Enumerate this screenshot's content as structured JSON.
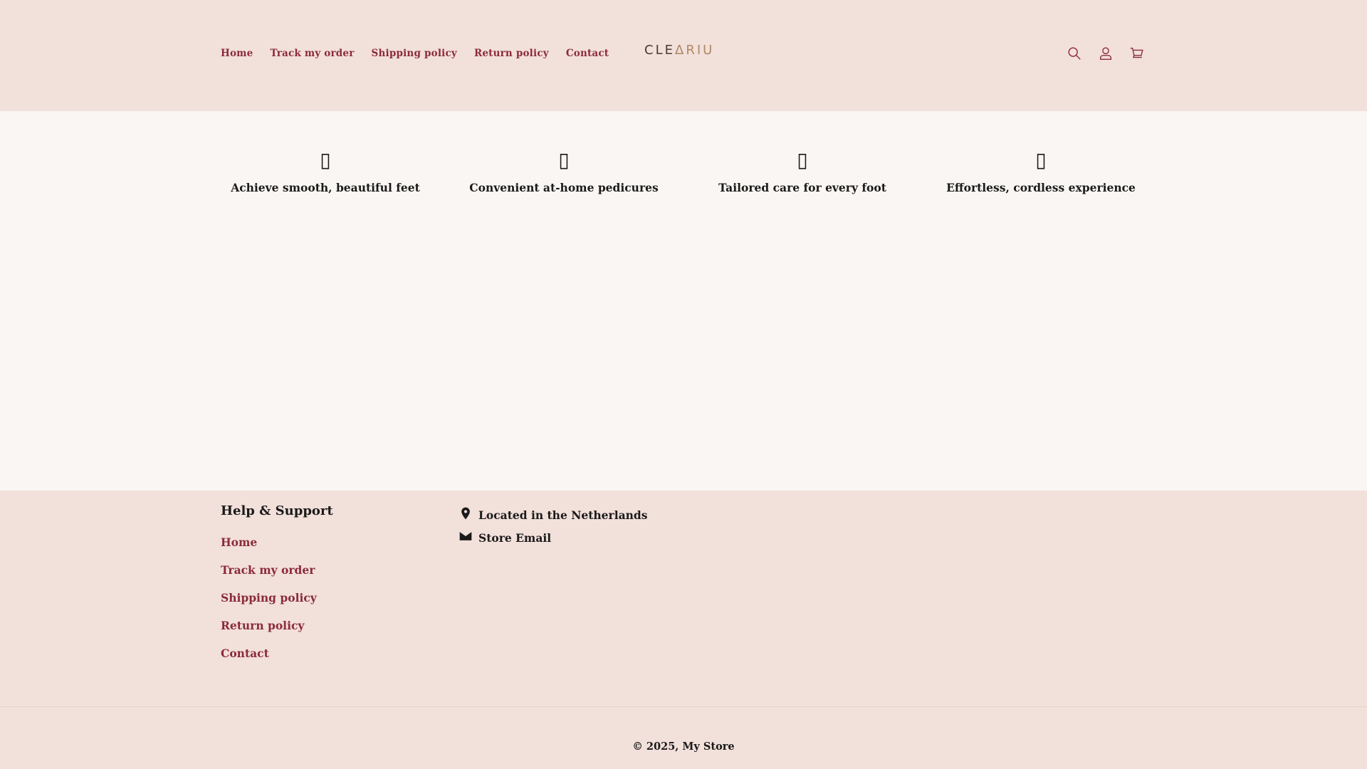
{
  "header": {
    "nav": [
      {
        "label": "Home"
      },
      {
        "label": "Track my order"
      },
      {
        "label": "Shipping policy"
      },
      {
        "label": "Return policy"
      },
      {
        "label": "Contact"
      }
    ],
    "logo": {
      "part1": "CLE",
      "mark": "Δ",
      "part2": "RIU"
    },
    "icons": [
      "search-icon",
      "account-icon",
      "cart-icon"
    ]
  },
  "features": [
    {
      "icon": "▯",
      "label": "Achieve smooth, beautiful feet"
    },
    {
      "icon": "▯",
      "label": "Convenient at-home pedicures"
    },
    {
      "icon": "▯",
      "label": "Tailored care for every foot"
    },
    {
      "icon": "▯",
      "label": "Effortless, cordless experience"
    }
  ],
  "footer": {
    "heading": "Help & Support",
    "links": [
      {
        "label": "Home"
      },
      {
        "label": "Track my order"
      },
      {
        "label": "Shipping policy"
      },
      {
        "label": "Return policy"
      },
      {
        "label": "Contact"
      }
    ],
    "contact": {
      "location": "Located in the Netherlands",
      "email": "Store Email"
    },
    "copyright": "© 2025, My Store"
  },
  "colors": {
    "header_bg": "#f2e0da",
    "body_bg": "#f9f6f3",
    "link": "#8b2b3a"
  }
}
